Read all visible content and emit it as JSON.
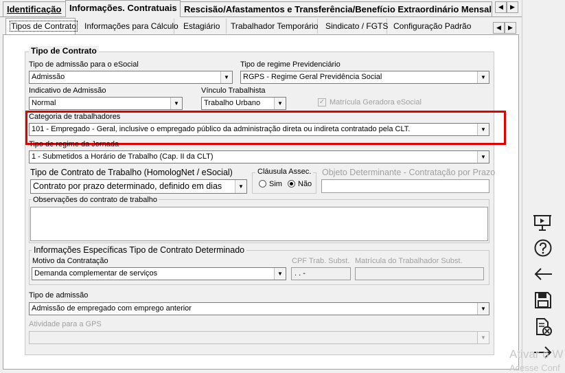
{
  "top_tabs": [
    {
      "label": "Identificação",
      "active": false
    },
    {
      "label": "Informações. Contratuais",
      "active": true
    },
    {
      "label": "Rescisão/Afastamentos e Transferência/Benefício Extraordinário Mensal",
      "active": false
    }
  ],
  "sub_tabs": [
    {
      "label": "Tipos de Contrato",
      "active": true
    },
    {
      "label": "Informações para Cálculo"
    },
    {
      "label": "Estagiário"
    },
    {
      "label": "Trabalhador Temporário"
    },
    {
      "label": "Sindicato / FGTS"
    },
    {
      "label": "Configuração Padrão"
    }
  ],
  "arrows": {
    "left": "◀",
    "right": "▶"
  },
  "group_tipo_contrato": {
    "title": "Tipo de Contrato"
  },
  "fields": {
    "tipo_admissao_esocial": {
      "label": "Tipo de admissão para o eSocial",
      "value": "Admissão"
    },
    "tipo_regime_prev": {
      "label": "Tipo de regime Previdenciário",
      "value": "RGPS - Regime Geral Previdência Social"
    },
    "indicativo_admissao": {
      "label": "Indicativo de Admissão",
      "value": "Normal"
    },
    "vinculo_trabalhista": {
      "label": "Vínculo Trabalhista",
      "value": "Trabalho Urbano"
    },
    "matricula_geradora": {
      "label": "Matrícula Geradora eSocial",
      "checked": true
    },
    "categoria_trabalhadores": {
      "label": "Categoria de trabalhadores",
      "value": "101 - Empregado - Geral, inclusive o empregado público da administração direta ou indireta contratado pela CLT."
    },
    "tipo_regime_jornada": {
      "label": "Tipo de regime da Jornada",
      "value": "1 - Submetidos a Horário de Trabalho (Cap. II da CLT)"
    },
    "tipo_contrato_trabalho": {
      "label": "Tipo de Contrato de Trabalho (HomologNet / eSocial)",
      "value": "Contrato por prazo determinado, definido em dias"
    },
    "clausula_assec": {
      "label": "Cláusula Assec.",
      "sim": "Sim",
      "nao": "Não",
      "selected": "Não"
    },
    "objeto_determinante": {
      "label": "Objeto Determinante - Contratação por Prazo",
      "value": ""
    },
    "observacoes": {
      "label": "Observações do contrato de trabalho",
      "value": ""
    },
    "tipo_admissao": {
      "label": "Tipo de admissão",
      "value": "Admissão de empregado com emprego anterior"
    },
    "atividade_gps": {
      "label": "Atividade para a GPS",
      "value": ""
    }
  },
  "group_info_especificas": {
    "title": "Informações Específicas Tipo de Contrato Determinado",
    "motivo": {
      "label": "Motivo da Contratação",
      "value": "Demanda complementar de serviços"
    },
    "cpf_subst": {
      "label": "CPF Trab. Subst.",
      "value": " .   .    -"
    },
    "matricula_subst": {
      "label": "Matrícula do Trabalhador Subst.",
      "value": ""
    }
  },
  "right_toolbar": [
    {
      "icon": "presentation-icon"
    },
    {
      "icon": "help-icon"
    },
    {
      "icon": "back-arrow-icon"
    },
    {
      "icon": "save-icon"
    },
    {
      "icon": "delete-document-icon"
    },
    {
      "icon": "forward-arrow-icon"
    }
  ],
  "watermark": {
    "line1": "Ativar o W",
    "line2": "Acesse Conf"
  },
  "colors": {
    "highlight": "#e00000",
    "background": "#f0f0f0"
  }
}
